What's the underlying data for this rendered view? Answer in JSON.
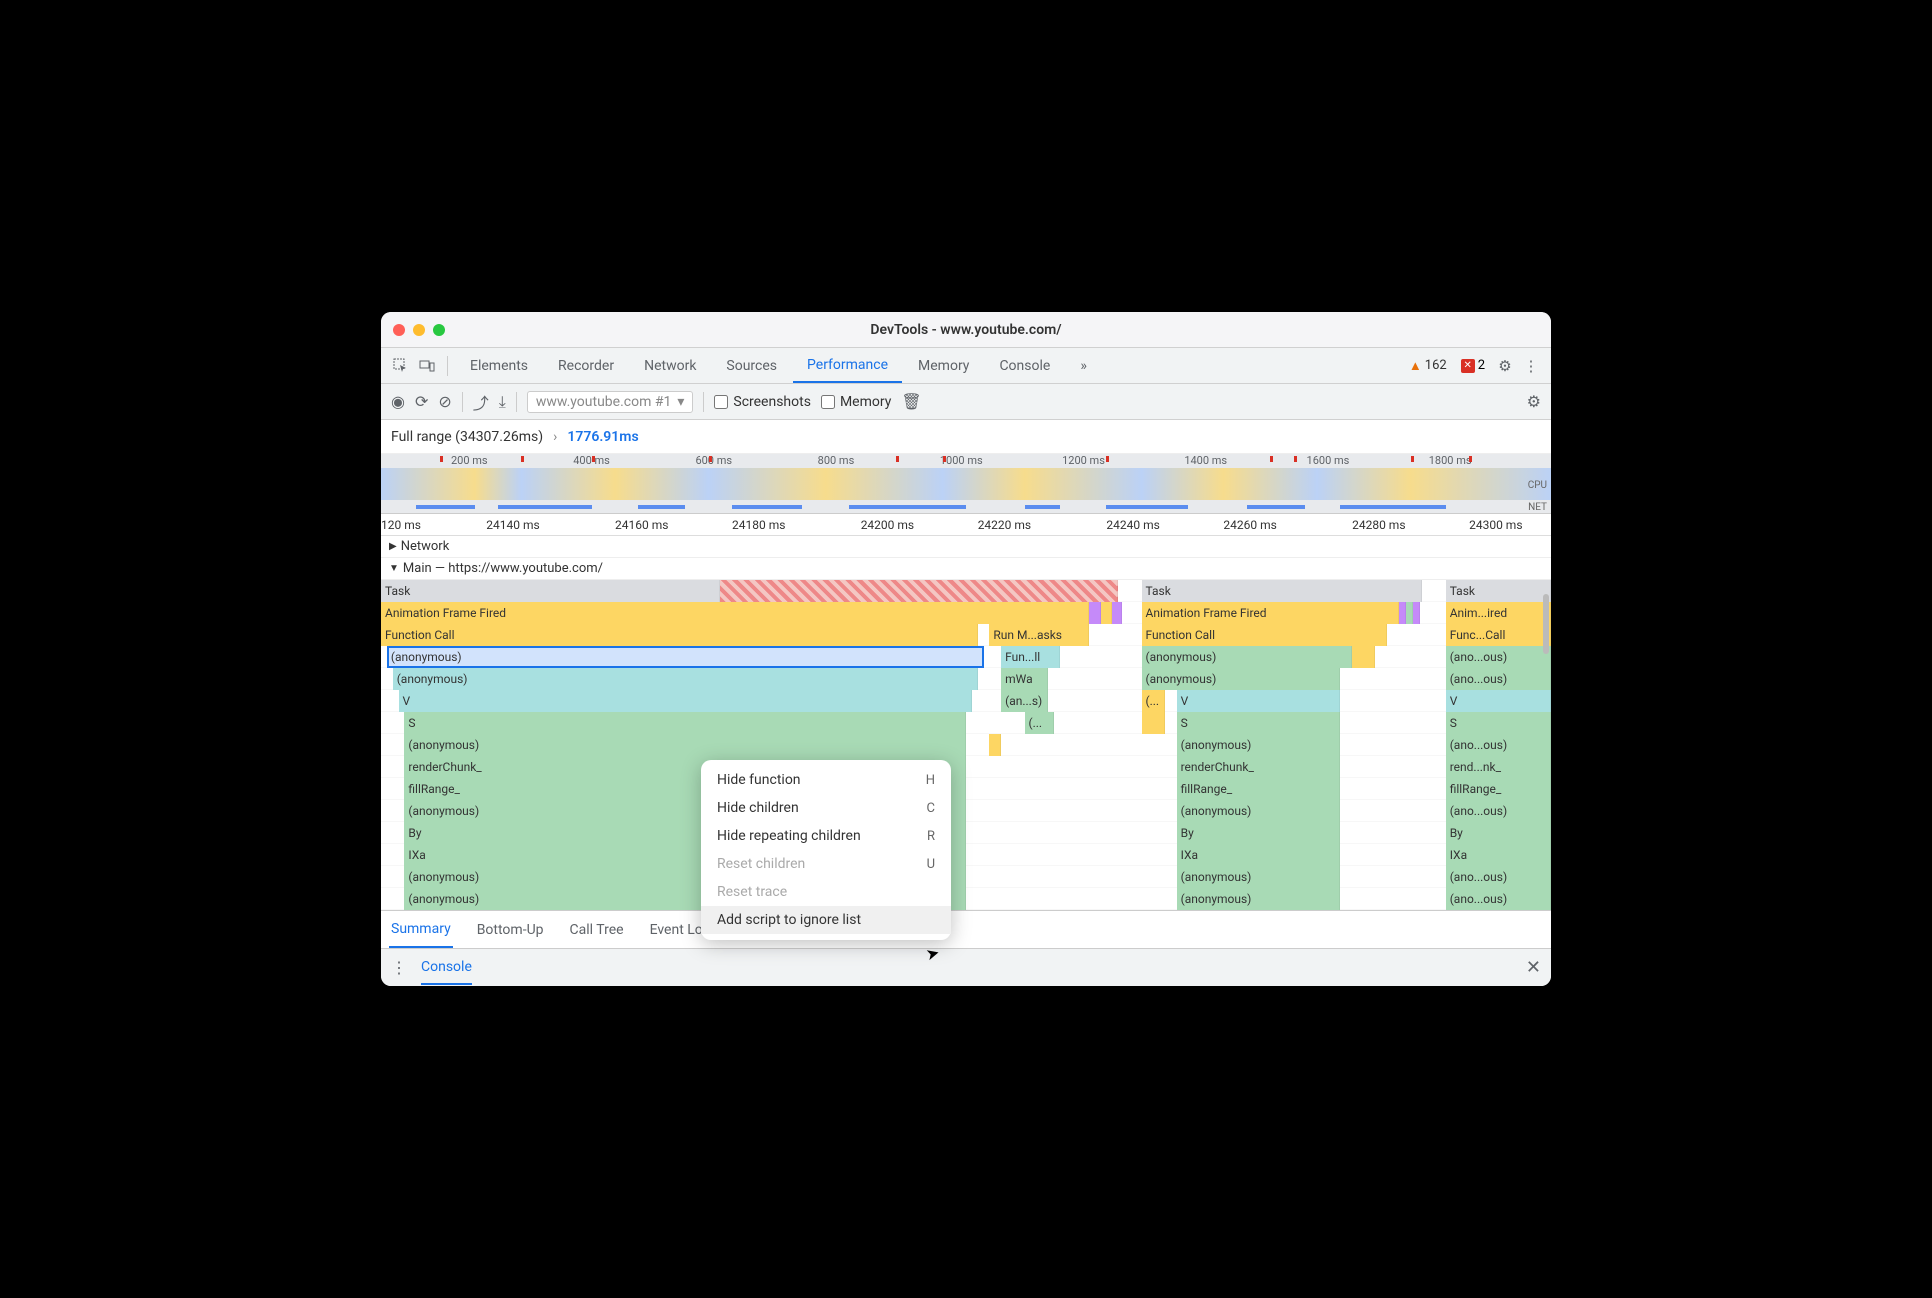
{
  "window": {
    "title": "DevTools - www.youtube.com/"
  },
  "tabs": {
    "items": [
      "Elements",
      "Recorder",
      "Network",
      "Sources",
      "Performance",
      "Memory",
      "Console"
    ],
    "active": "Performance",
    "overflow": "»",
    "warn_count": "162",
    "err_count": "2"
  },
  "toolbar": {
    "recording_name": "www.youtube.com #1",
    "screenshots_label": "Screenshots",
    "memory_label": "Memory"
  },
  "range": {
    "full_label": "Full range (34307.26ms)",
    "selected": "1776.91ms"
  },
  "overview_ticks": [
    "200 ms",
    "400 ms",
    "600 ms",
    "800 ms",
    "1000 ms",
    "1200 ms",
    "1400 ms",
    "1600 ms",
    "1800 ms"
  ],
  "overview_labels": {
    "cpu": "CPU",
    "net": "NET"
  },
  "timeline_ticks": [
    "120 ms",
    "24140 ms",
    "24160 ms",
    "24180 ms",
    "24200 ms",
    "24220 ms",
    "24240 ms",
    "24260 ms",
    "24280 ms",
    "24300 ms"
  ],
  "tracks": {
    "network": "Network",
    "main": "Main — https://www.youtube.com/"
  },
  "flame": {
    "col1": [
      "Task",
      "Animation Frame Fired",
      "Function Call",
      "(anonymous)",
      "(anonymous)",
      "V",
      "S",
      "(anonymous)",
      "renderChunk_",
      "fillRange_",
      "(anonymous)",
      "By",
      "IXa",
      "(anonymous)",
      "(anonymous)"
    ],
    "col1b": [
      "Run M...asks",
      "Fun...ll",
      "mWa",
      "(an...s)",
      "(..."
    ],
    "col2": [
      "Task",
      "Animation Frame Fired",
      "Function Call",
      "(anonymous)",
      "(anonymous)",
      "V",
      "S",
      "(anonymous)",
      "renderChunk_",
      "fillRange_",
      "(anonymous)",
      "By",
      "IXa",
      "(anonymous)",
      "(anonymous)"
    ],
    "col2a": "(...",
    "col3": [
      "Task",
      "Anim...ired",
      "Func...Call",
      "(ano...ous)",
      "(ano...ous)",
      "V",
      "S",
      "(ano...ous)",
      "rend...nk_",
      "fillRange_",
      "(ano...ous)",
      "By",
      "IXa",
      "(ano...ous)",
      "(ano...ous)"
    ]
  },
  "context_menu": {
    "items": [
      {
        "label": "Hide function",
        "kbd": "H",
        "disabled": false
      },
      {
        "label": "Hide children",
        "kbd": "C",
        "disabled": false
      },
      {
        "label": "Hide repeating children",
        "kbd": "R",
        "disabled": false
      },
      {
        "label": "Reset children",
        "kbd": "U",
        "disabled": true
      },
      {
        "label": "Reset trace",
        "kbd": "",
        "disabled": true
      },
      {
        "label": "Add script to ignore list",
        "kbd": "",
        "disabled": false,
        "hover": true
      }
    ]
  },
  "bottom_tabs": {
    "items": [
      "Summary",
      "Bottom-Up",
      "Call Tree",
      "Event Log"
    ],
    "active": "Summary"
  },
  "console_drawer": {
    "label": "Console"
  }
}
